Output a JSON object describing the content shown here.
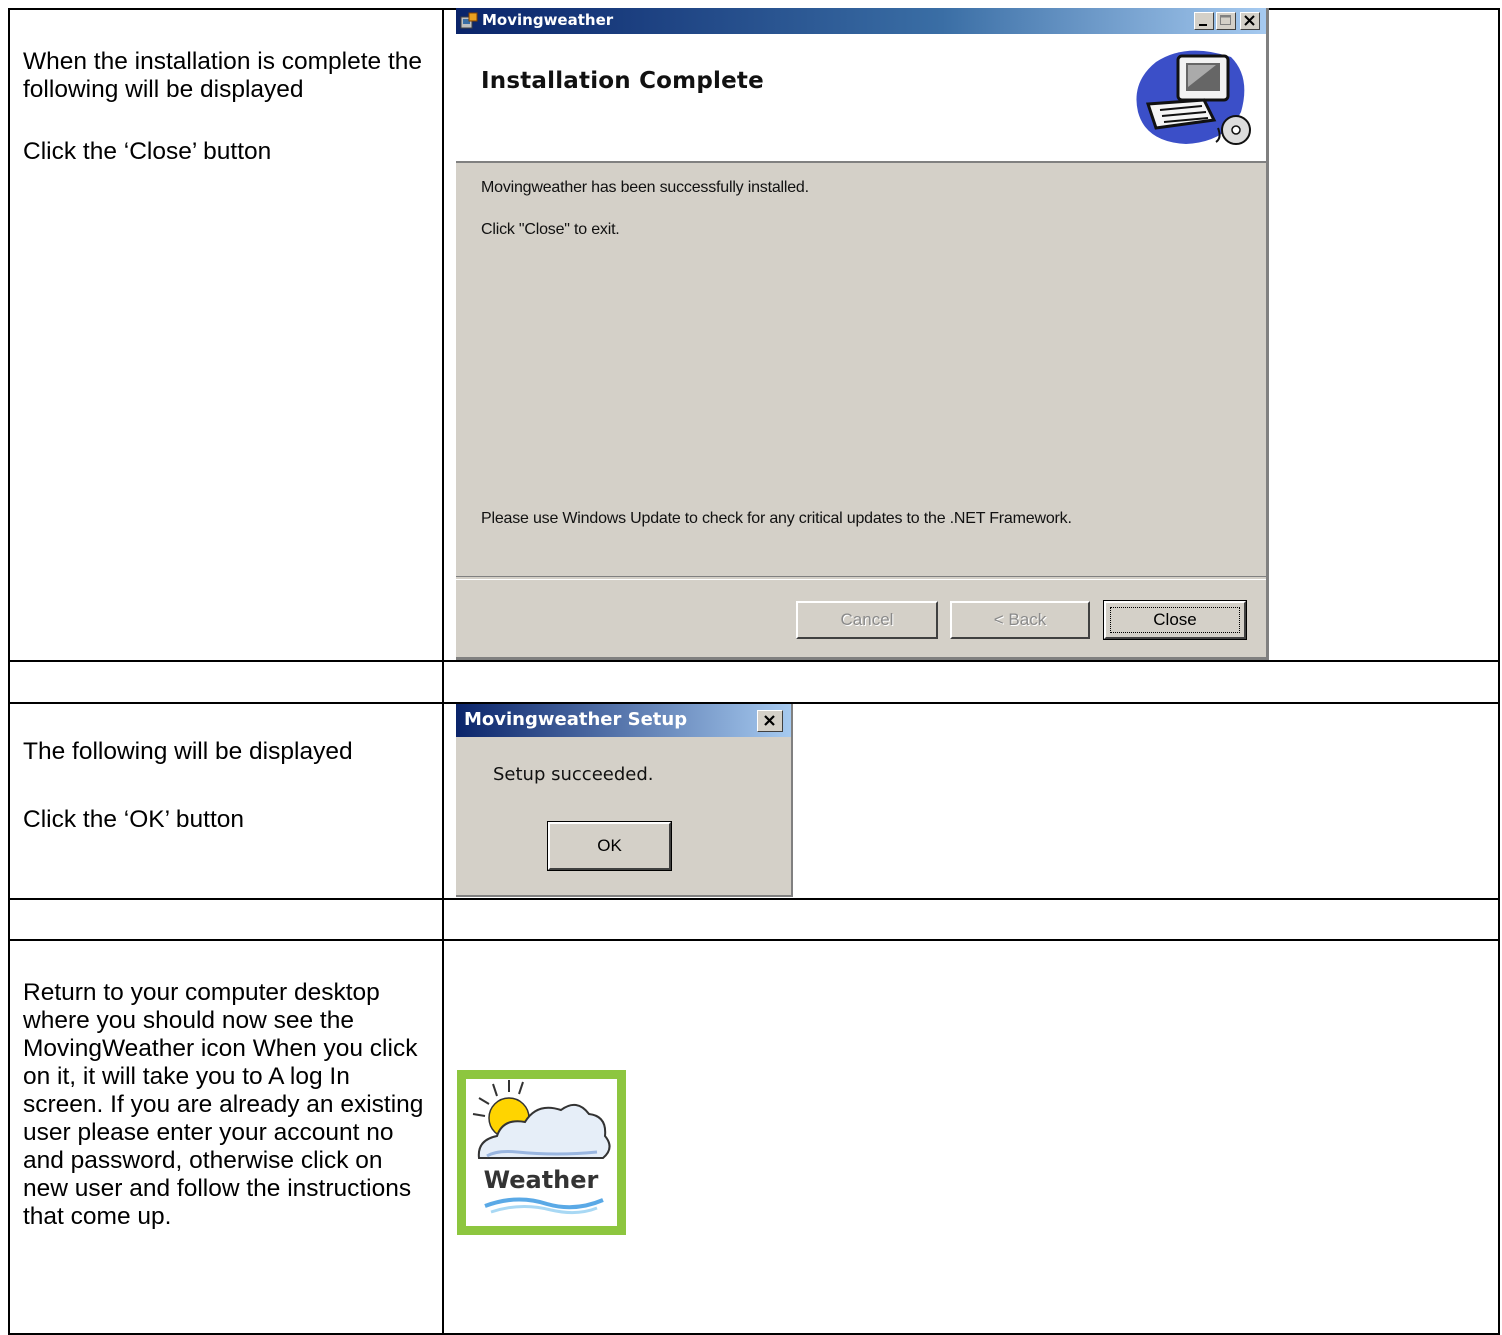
{
  "rows": [
    {
      "instructions": [
        "When the installation is complete the following will be displayed",
        "Click the ‘Close’ button"
      ]
    },
    {
      "instructions": [
        "The following will be displayed",
        "Click the ‘OK’ button"
      ]
    },
    {
      "instructions": [
        "Return to your computer desktop where you should now see the MovingWeather icon When you click on it, it will take you to A log In screen. If you are already an existing user please enter your account no and password, otherwise click on new user and follow the instructions that come up."
      ]
    }
  ],
  "dialog_install": {
    "title": "Movingweather",
    "heading": "Installation Complete",
    "line1": "Movingweather has been successfully installed.",
    "line2": "Click \"Close\" to exit.",
    "line3": "Please use Windows Update to check for any critical updates to the .NET Framework.",
    "cancel": "Cancel",
    "back": "< Back",
    "close": "Close"
  },
  "dialog_setup": {
    "title": "Movingweather Setup",
    "message": "Setup succeeded.",
    "ok": "OK"
  },
  "desktop_icon": {
    "label": "Weather",
    "border_color": "#8dc63f"
  },
  "colors": {
    "titlebar_start": "#0a246a",
    "titlebar_end": "#a6caf0",
    "dialog_face": "#d4d0c8"
  }
}
